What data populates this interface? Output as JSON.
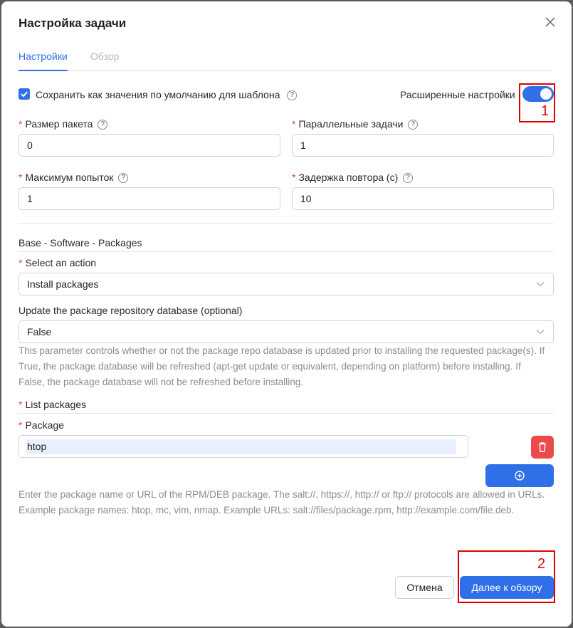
{
  "dialog": {
    "title": "Настройка задачи",
    "tabs": [
      {
        "label": "Настройки",
        "active": true
      },
      {
        "label": "Обзор",
        "active": false
      }
    ]
  },
  "options": {
    "save_default_label": "Сохранить как значения по умолчанию для шаблона",
    "save_default_checked": true,
    "advanced_label": "Расширенные настройки",
    "advanced_on": true
  },
  "fields": {
    "batch_size": {
      "label": "Размер пакета",
      "value": "0"
    },
    "parallel_tasks": {
      "label": "Параллельные задачи",
      "value": "1"
    },
    "max_retries": {
      "label": "Максимум попыток",
      "value": "1"
    },
    "retry_delay": {
      "label": "Задержка повтора (с)",
      "value": "10"
    }
  },
  "module": {
    "title": "Base - Software - Packages",
    "action": {
      "label": "Select an action",
      "value": "Install packages"
    },
    "update_repo": {
      "label": "Update the package repository database (optional)",
      "value": "False",
      "hint": "This parameter controls whether or not the package repo database is updated prior to installing the requested package(s). If True, the package database will be refreshed (apt-get update or equivalent, depending on platform) before installing. If False, the package database will not be refreshed before installing."
    },
    "list_title": "List packages",
    "package": {
      "label": "Package",
      "value": "htop",
      "hint": "Enter the package name or URL of the RPM/DEB package. The salt://, https://, http:// or ftp:// protocols are allowed in URLs. Example package names: htop, mc, vim, nmap. Example URLs: salt://files/package.rpm, http://example.com/file.deb."
    }
  },
  "annotations": {
    "one": "1",
    "two": "2"
  },
  "footer": {
    "cancel_label": "Отмена",
    "next_label": "Далее к обзору"
  },
  "colors": {
    "primary": "#2f6fe8",
    "danger": "#ec4a4a",
    "annotation": "#e10000"
  }
}
